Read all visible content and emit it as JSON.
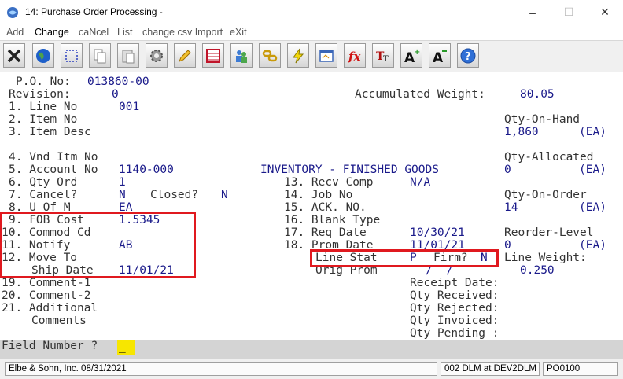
{
  "window": {
    "title": "14: Purchase Order Processing -"
  },
  "menu": {
    "add": "Add",
    "change": "Change",
    "cancel": "caNcel",
    "list": "List",
    "csv": "change csv Import",
    "exit": "eXit"
  },
  "toolbar_icons": [
    "close-icon",
    "globe-icon",
    "select-icon",
    "copy-icon",
    "paste-icon",
    "settings-icon",
    "edit-icon",
    "table-icon",
    "users-icon",
    "link-icon",
    "lightning-icon",
    "window-icon",
    "function-icon",
    "text-format-icon",
    "font-increase-icon",
    "font-decrease-icon",
    "help-icon"
  ],
  "screen": {
    "po_label": "P.O. No:",
    "po_value": "013860-00",
    "rev_label": "Revision:",
    "rev_value": "0",
    "accw_label": "Accumulated Weight:",
    "accw_value": "80.05",
    "l1": "1. Line No",
    "l1v": "001",
    "l2": "2. Item No",
    "l3": "3. Item Desc",
    "l4": "4. Vnd Itm No",
    "l5": "5. Account No",
    "l5v": "1140-000",
    "acct_desc": "INVENTORY - FINISHED GOODS",
    "l6": "6. Qty Ord",
    "l6v": "1",
    "l7": "7. Cancel?",
    "l7v": "N",
    "closed_label": "Closed?",
    "closed_value": "N",
    "l8": "8. U Of M",
    "l8v": "EA",
    "l9": "9. FOB Cost",
    "l9v": "1.5345",
    "l10": "10. Commod Cd",
    "l11": "11. Notify",
    "l11v": "AB",
    "l12": "12. Move To",
    "ship_label": "Ship Date",
    "ship_value": "11/01/21",
    "l19": "19. Comment-1",
    "l20": "20. Comment-2",
    "l21": "21. Additional",
    "l21b": "Comments",
    "l13": "13. Recv Comp",
    "l13v": "N/A",
    "l14": "14. Job No",
    "l15": "15. ACK. NO.",
    "l16": "16. Blank Type",
    "l17": "17. Req Date",
    "l17v": "10/30/21",
    "l18": "18. Prom Date",
    "l18v": "11/01/21",
    "linestat_label": "Line Stat",
    "linestat_value": "P",
    "firm_label": "Firm?",
    "firm_value": "N",
    "origprom_label": "Orig Prom",
    "origprom_value": "/  /",
    "qoh_label": "Qty-On-Hand",
    "qoh_value": "1,860",
    "qoh_uom": "(EA)",
    "qal_label": "Qty-Allocated",
    "qal_value": "0",
    "qal_uom": "(EA)",
    "qoo_label": "Qty-On-Order",
    "qoo_value": "14",
    "qoo_uom": "(EA)",
    "rol_label": "Reorder-Level",
    "rol_value": "0",
    "rol_uom": "(EA)",
    "lw_label": "Line Weight:",
    "lw_value": "0.250",
    "receipt_date": "Receipt Date:",
    "qty_received": "Qty Received:",
    "qty_rejected": "Qty Rejected:",
    "qty_invoiced": "Qty Invoiced:",
    "qty_pending": "Qty Pending :"
  },
  "field_prompt": {
    "label": "Field Number ?",
    "value": "_"
  },
  "status": {
    "company": "Elbe & Sohn, Inc. 08/31/2021",
    "session": "002 DLM at DEV2DLM",
    "program": "PO0100"
  },
  "colors": {
    "highlight": "#e0191f",
    "input": "#f7e600",
    "value_text": "#1a1a8a"
  }
}
